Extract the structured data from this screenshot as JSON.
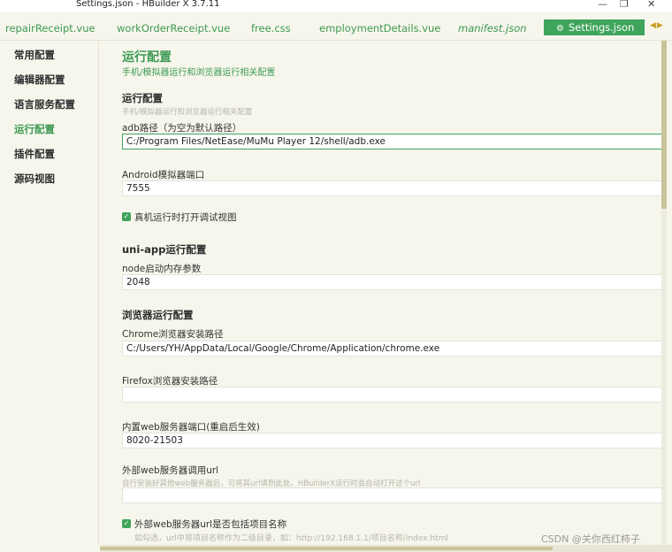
{
  "window": {
    "title": "Settings.json - HBuilder X 3.7.11",
    "controls": [
      "—",
      "❐",
      "✕"
    ]
  },
  "tabs": [
    {
      "label": "repairReceipt.vue"
    },
    {
      "label": "workOrderReceipt.vue"
    },
    {
      "label": "free.css"
    },
    {
      "label": "employmentDetails.vue"
    },
    {
      "label": "manifest.json"
    },
    {
      "label": "Settings.json"
    }
  ],
  "tab_arrows": "◀▶",
  "sidebar": {
    "items": [
      {
        "label": "常用配置"
      },
      {
        "label": "编辑器配置"
      },
      {
        "label": "语言服务配置"
      },
      {
        "label": "运行配置"
      },
      {
        "label": "插件配置"
      },
      {
        "label": "源码视图"
      }
    ],
    "active": "运行配置"
  },
  "main": {
    "title": "运行配置",
    "subtitle": "手机/模拟器运行和浏览器运行相关配置",
    "run_section": {
      "title": "运行配置",
      "subtitle": "手机/模拟器运行和浏览器运行相关配置",
      "adb_label": "adb路径（为空为默认路径）",
      "adb_value": "C:/Program Files/NetEase/MuMu Player 12/shell/adb.exe",
      "android_port_label": "Android模拟器端口",
      "android_port_value": "7555",
      "debug_view_label": "真机运行时打开调试视图",
      "debug_view_checked": true
    },
    "uniapp_section": {
      "title": "uni-app运行配置",
      "node_mem_label": "node启动内存参数",
      "node_mem_value": "2048"
    },
    "browser_section": {
      "title": "浏览器运行配置",
      "chrome_label": "Chrome浏览器安装路径",
      "chrome_value": "C:/Users/YH/AppData/Local/Google/Chrome/Application/chrome.exe",
      "firefox_label": "Firefox浏览器安装路径",
      "firefox_value": "",
      "web_port_label": "内置web服务器端口(重启后生效)",
      "web_port_value": "8020-21503",
      "ext_web_label": "外部web服务器调用url",
      "ext_web_hint": "自行安装好其他web服务器后，可将其url填到此处。HBuilderX运行时会自动打开这个url",
      "ext_web_value": "",
      "include_name_label": "外部web服务器url是否包括项目名称",
      "include_name_checked": true,
      "include_name_hint": "如勾选，url中将项目名称作为二级目录，如：http://192.168.1.1/项目名称/index.html"
    }
  },
  "watermark": "CSDN @关你西红柿子",
  "colors": {
    "accent": "#3fa45c",
    "background": "#f7f6ec",
    "scroll_thumb": "#c9c39a"
  }
}
